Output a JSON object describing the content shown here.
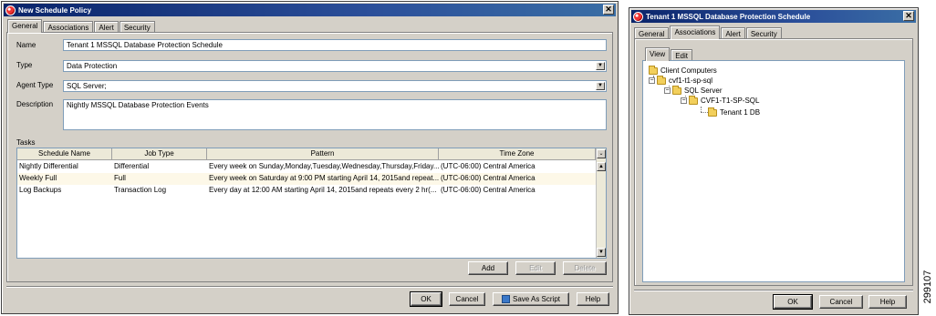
{
  "dialog1": {
    "title": "New Schedule Policy",
    "close": "✕",
    "tabs": [
      "General",
      "Associations",
      "Alert",
      "Security"
    ],
    "name_label": "Name",
    "name_value": "Tenant 1 MSSQL Database Protection Schedule",
    "type_label": "Type",
    "type_value": "Data Protection",
    "agent_label": "Agent Type",
    "agent_value": "SQL Server;",
    "desc_label": "Description",
    "desc_value": "Nightly MSSQL Database Protection Events",
    "tasks_label": "Tasks",
    "columns": [
      "Schedule Name",
      "Job Type",
      "Pattern",
      "Time Zone"
    ],
    "rows": [
      [
        "Nightly Differential",
        "Differential",
        "Every week on Sunday,Monday,Tuesday,Wednesday,Thursday,Friday...",
        "(UTC-06:00) Central America"
      ],
      [
        "Weekly Full",
        "Full",
        "Every week on Saturday at 9:00 PM  starting April 14, 2015and repeat...",
        "(UTC-06:00) Central America"
      ],
      [
        "Log Backups",
        "Transaction Log",
        "Every day at 12:00 AM  starting April 14, 2015and repeats every 2 hr(...",
        "(UTC-06:00) Central America"
      ]
    ],
    "add": "Add",
    "edit": "Edit",
    "delete": "Delete",
    "ok": "OK",
    "cancel": "Cancel",
    "save_script": "Save As Script",
    "help": "Help"
  },
  "dialog2": {
    "title": "Tenant 1 MSSQL Database Protection Schedule",
    "close": "✕",
    "tabs": [
      "General",
      "Associations",
      "Alert",
      "Security"
    ],
    "subtabs": [
      "View",
      "Edit"
    ],
    "tree": {
      "root": "Client Computers",
      "client": "cvf1-t1-sp-sql",
      "agent": "SQL Server",
      "instance": "CVF1-T1-SP-SQL",
      "db": "Tenant 1 DB"
    },
    "ok": "OK",
    "cancel": "Cancel",
    "help": "Help"
  },
  "figure_code": "299107",
  "icons": [
    "app-icon",
    "close-icon",
    "combo-arrow-icon",
    "folder-icon",
    "expander-minus-icon",
    "script-icon",
    "scroll-up-icon",
    "scroll-down-icon"
  ]
}
